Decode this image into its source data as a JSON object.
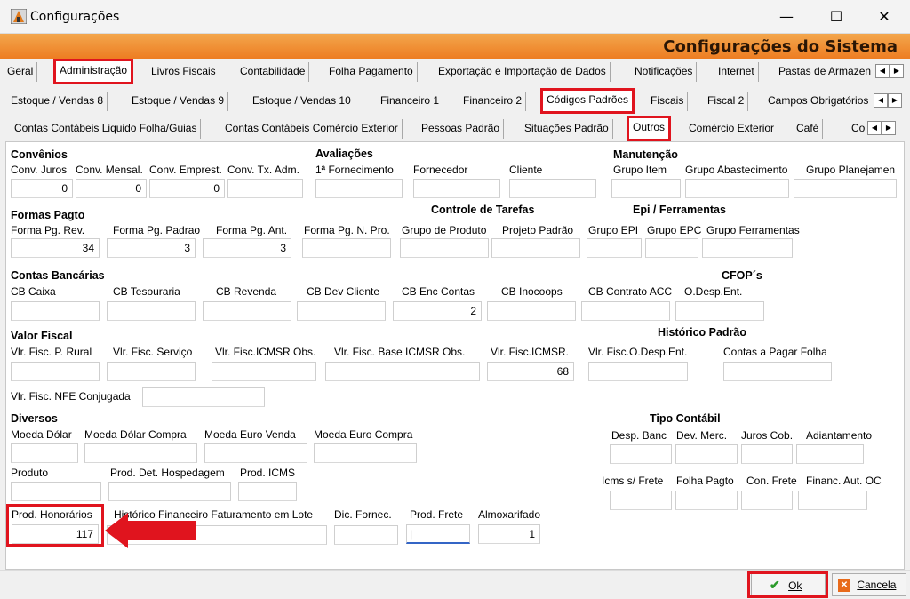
{
  "window": {
    "title": "Configurações",
    "minimize": "—",
    "maximize": "☐",
    "close": "✕"
  },
  "banner": {
    "title": "Configurações do Sistema"
  },
  "tabs1": [
    "Geral",
    "Administração",
    "Livros Fiscais",
    "Contabilidade",
    "Folha Pagamento",
    "Exportação e Importação de Dados",
    "Notificações",
    "Internet",
    "Pastas de Armazen"
  ],
  "tabs2": [
    "Estoque / Vendas 8",
    "Estoque / Vendas 9",
    "Estoque / Vendas 10",
    "Financeiro 1",
    "Financeiro 2",
    "Códigos Padrões",
    "Fiscais",
    "Fiscal 2",
    "Campos Obrigatórios"
  ],
  "tabs3": [
    "Contas Contábeis Liquido Folha/Guias",
    "Contas Contábeis Comércio Exterior",
    "Pessoas Padrão",
    "Situações Padrão",
    "Outros",
    "Comércio Exterior",
    "Café",
    "Co"
  ],
  "sections": {
    "convenios": "Convênios",
    "avaliacoes": "Avaliações",
    "manutencao": "Manutenção",
    "formas": "Formas Pagto",
    "controle": "Controle de Tarefas",
    "epi": "Epi / Ferramentas",
    "contas": "Contas Bancárias",
    "cfop": "CFOP´s",
    "valor": "Valor Fiscal",
    "historico": "Histórico Padrão",
    "diversos": "Diversos",
    "tipo": "Tipo Contábil"
  },
  "conv": {
    "juros_l": "Conv. Juros",
    "juros_v": "0",
    "mensal_l": "Conv. Mensal.",
    "mensal_v": "0",
    "emprest_l": "Conv. Emprest.",
    "emprest_v": "0",
    "tx_l": "Conv. Tx. Adm.",
    "tx_v": ""
  },
  "aval": {
    "forn1_l": "1ª Fornecimento",
    "forn_l": "Fornecedor",
    "cli_l": "Cliente"
  },
  "manut": {
    "item_l": "Grupo Item",
    "abast_l": "Grupo Abastecimento",
    "plan_l": "Grupo Planejamen"
  },
  "formas": {
    "rev_l": "Forma Pg. Rev.",
    "rev_v": "34",
    "padrao_l": "Forma Pg. Padrao",
    "padrao_v": "3",
    "ant_l": "Forma Pg. Ant.",
    "ant_v": "3",
    "npro_l": "Forma Pg. N. Pro."
  },
  "tarefas": {
    "produto_l": "Grupo de Produto",
    "projeto_l": "Projeto Padrão"
  },
  "epi": {
    "epi_l": "Grupo EPI",
    "epc_l": "Grupo EPC",
    "ferr_l": "Grupo Ferramentas"
  },
  "contas": {
    "caixa_l": "CB Caixa",
    "tes_l": "CB Tesouraria",
    "rev_l": "CB Revenda",
    "dev_l": "CB Dev Cliente",
    "enc_l": "CB Enc Contas",
    "enc_v": "2",
    "ino_l": "CB Inocoops",
    "acc_l": "CB Contrato ACC",
    "odesp_l": "O.Desp.Ent."
  },
  "valor": {
    "rural_l": "Vlr. Fisc. P. Rural",
    "serv_l": "Vlr. Fisc. Serviço",
    "icmsr_obs_l": "Vlr. Fisc.ICMSR Obs.",
    "base_l": "Vlr. Fisc. Base ICMSR Obs.",
    "icmsr_l": "Vlr. Fisc.ICMSR.",
    "icmsr_v": "68",
    "odesp_l": "Vlr. Fisc.O.Desp.Ent.",
    "pagar_l": "Contas a Pagar Folha",
    "nfe_l": "Vlr. Fisc. NFE Conjugada"
  },
  "diversos": {
    "dolar_l": "Moeda Dólar",
    "dolarc_l": "Moeda Dólar Compra",
    "eurov_l": "Moeda Euro Venda",
    "euroc_l": "Moeda Euro Compra",
    "produto_l": "Produto",
    "hosp_l": "Prod. Det. Hospedagem",
    "icms_l": "Prod. ICMS",
    "hon_l": "Prod. Honorários",
    "hon_v": "117",
    "hist_l": "Histórico Financeiro Faturamento em Lote",
    "dic_l": "Dic. Fornec.",
    "frete_l": "Prod. Frete",
    "almox_l": "Almoxarifado",
    "almox_v": "1"
  },
  "tipo": {
    "banc_l": "Desp. Banc",
    "merc_l": "Dev. Merc.",
    "juros_l": "Juros Cob.",
    "adiant_l": "Adiantamento",
    "icmsf_l": "Icms s/ Frete",
    "folha_l": "Folha Pagto",
    "confrete_l": "Con. Frete",
    "financ_l": "Financ. Aut. OC"
  },
  "buttons": {
    "ok": "Ok",
    "cancel": "Cancela"
  },
  "colors": {
    "accent_red": "#e0141e",
    "banner_orange": "#ed7d22"
  }
}
